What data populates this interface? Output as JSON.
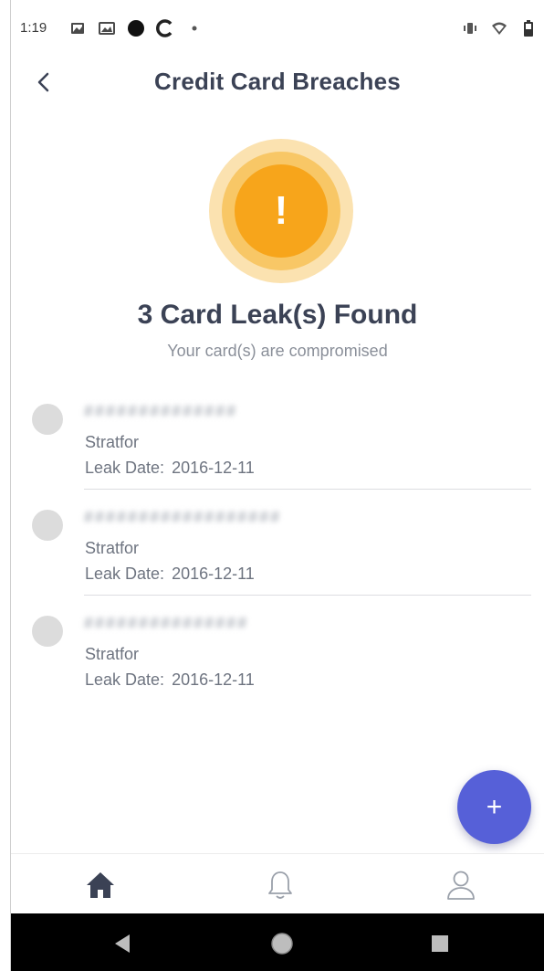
{
  "status_bar": {
    "time": "1:19",
    "left_icons": [
      "image-icon",
      "photo-icon",
      "dot-icon",
      "c-icon",
      "small-dot-icon"
    ],
    "right_icons": [
      "vibrate-icon",
      "wifi-icon",
      "battery-icon"
    ]
  },
  "header": {
    "title": "Credit Card Breaches",
    "back_icon": "chevron-left-icon"
  },
  "summary": {
    "alert_icon": "!",
    "title": "3 Card Leak(s) Found",
    "subtitle": "Your card(s) are compromised"
  },
  "leaks": [
    {
      "card_number": "##############",
      "source": "Stratfor",
      "date_label": "Leak Date:",
      "date": "2016-12-11"
    },
    {
      "card_number": "##################",
      "source": "Stratfor",
      "date_label": "Leak Date:",
      "date": "2016-12-11"
    },
    {
      "card_number": "###############",
      "source": "Stratfor",
      "date_label": "Leak Date:",
      "date": "2016-12-11"
    }
  ],
  "fab": {
    "label": "+"
  },
  "tabs": [
    {
      "icon": "home-icon",
      "active": true
    },
    {
      "icon": "bell-icon",
      "active": false
    },
    {
      "icon": "profile-icon",
      "active": false
    }
  ],
  "nav_bar": {
    "icons": [
      "back-triangle-icon",
      "home-circle-icon",
      "recents-square-icon"
    ]
  },
  "colors": {
    "accent": "#5660d8",
    "alert_orange": "#f7a51b",
    "title_text": "#3b4255"
  }
}
